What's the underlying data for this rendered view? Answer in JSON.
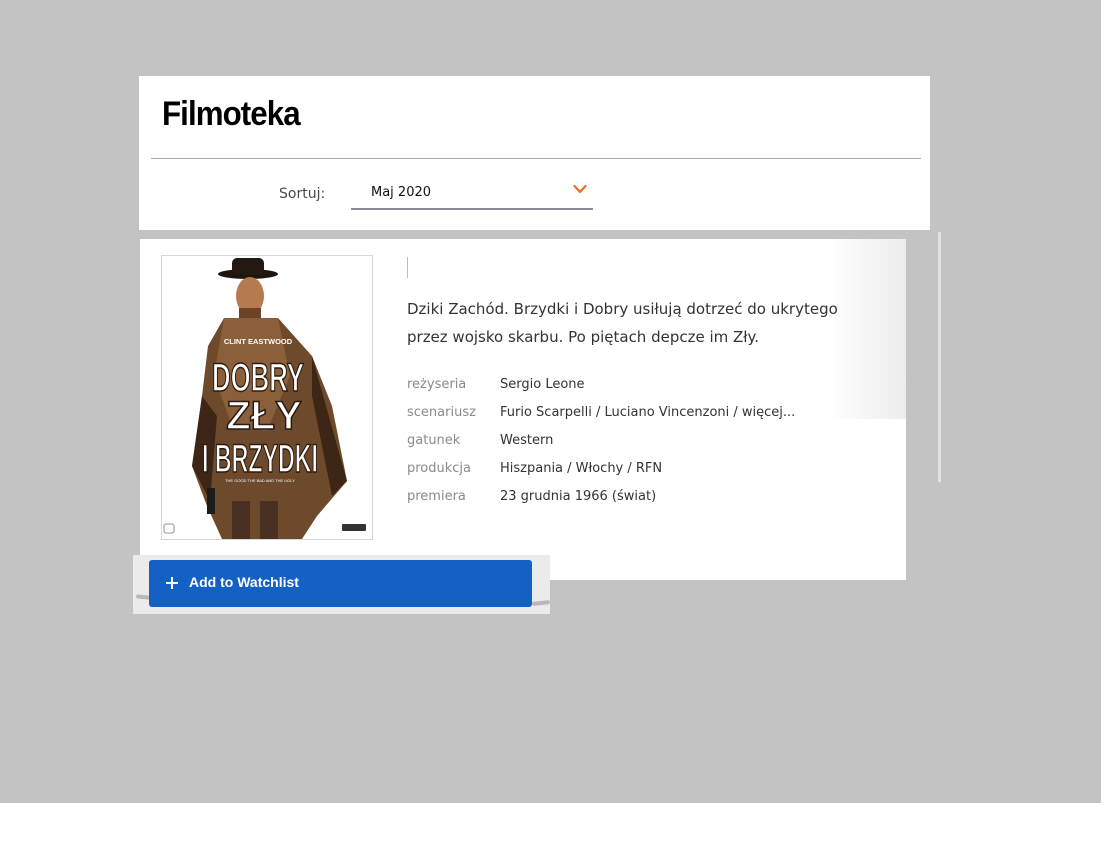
{
  "header": {
    "site_title": "Filmoteka",
    "sort_label": "Sortuj:",
    "sort_value": "Maj 2020"
  },
  "movie": {
    "poster": {
      "top_credit": "CLINT EASTWOOD",
      "title_lines": [
        "DOBRY",
        "ZŁY",
        "I BRZYDKI"
      ],
      "tagline": "THE GOOD THE BAD AND THE UGLY"
    },
    "synopsis": "Dziki Zachód. Brzydki i Dobry usiłują dotrzeć do ukrytego przez wojsko skarbu. Po piętach depcze im Zły.",
    "details": [
      {
        "label": "reżyseria",
        "value": "Sergio Leone"
      },
      {
        "label": "scenariusz",
        "value": "Furio Scarpelli / Luciano Vincenzoni / więcej..."
      },
      {
        "label": "gatunek",
        "value": "Western"
      },
      {
        "label": "produkcja",
        "value": "Hiszpania / Włochy / RFN"
      },
      {
        "label": "premiera",
        "value": "23 grudnia 1966 (świat)"
      }
    ]
  },
  "watchlist": {
    "label": "Add to Watchlist",
    "icon": "plus-icon"
  },
  "colors": {
    "page_background": "#c3c3c3",
    "accent_orange": "#e8701c",
    "button_blue": "#1361c4"
  }
}
